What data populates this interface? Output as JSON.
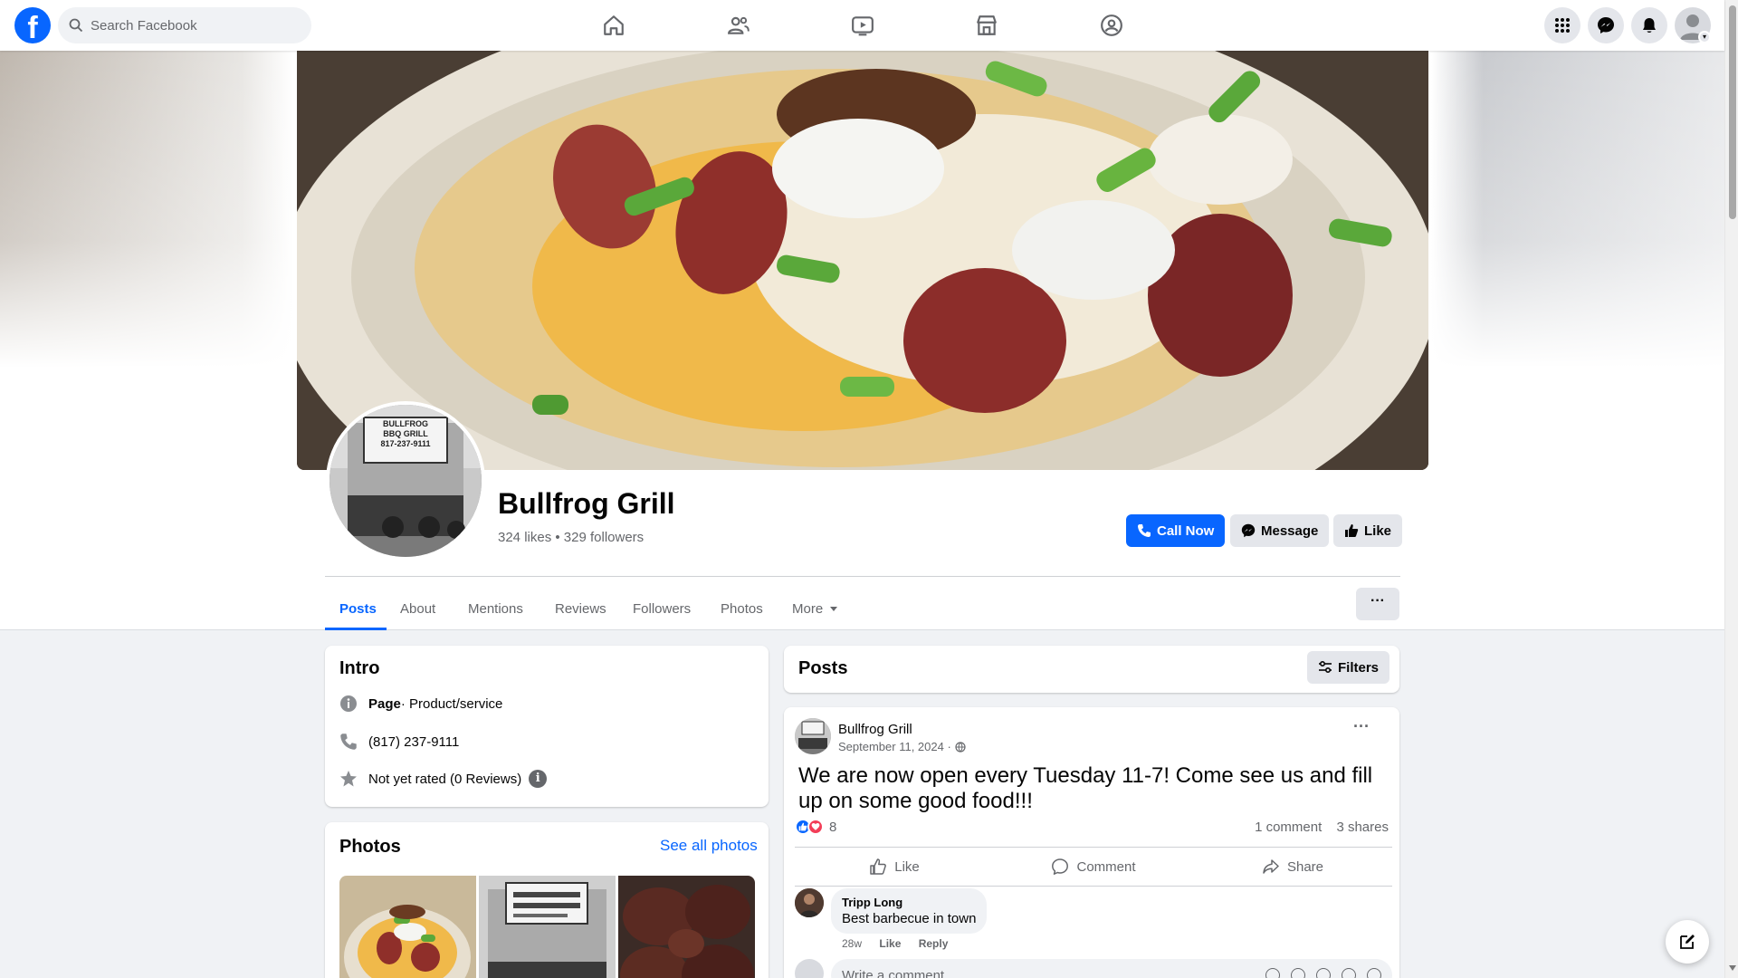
{
  "topbar": {
    "search_placeholder": "Search Facebook",
    "nav": [
      "home-icon",
      "friends-icon",
      "video-icon",
      "marketplace-icon",
      "gaming-icon"
    ],
    "right": [
      "menu-grid-icon",
      "messenger-icon",
      "notifications-icon",
      "account-avatar"
    ]
  },
  "page": {
    "name": "Bullfrog Grill",
    "stats": "324 likes • 329 followers",
    "profile_sign_line1": "BULLFROG",
    "profile_sign_line2": "BBQ GRILL",
    "profile_sign_line3": "817-237-9111"
  },
  "buttons": {
    "call_now": "Call Now",
    "message": "Message",
    "like": "Like",
    "more_options": "···"
  },
  "tabs": [
    {
      "label": "Posts"
    },
    {
      "label": "About"
    },
    {
      "label": "Mentions"
    },
    {
      "label": "Reviews"
    },
    {
      "label": "Followers"
    },
    {
      "label": "Photos"
    },
    {
      "label": "More"
    }
  ],
  "intro": {
    "title": "Intro",
    "category_bold": "Page",
    "category_rest": " · Product/service",
    "phone": "(817) 237-9111",
    "rating": "Not yet rated (0 Reviews)",
    "info_glyph": "i"
  },
  "photos": {
    "title": "Photos",
    "see_all": "See all photos"
  },
  "posts_header": {
    "title": "Posts",
    "filters": "Filters"
  },
  "post": {
    "author": "Bullfrog Grill",
    "date": "September 11, 2024 ·",
    "menu": "···",
    "text": "We are now open every Tuesday 11-7! Come see us and fill up on some good food!!!",
    "reaction_count": "8",
    "comments": "1 comment",
    "shares": "3 shares",
    "actions": {
      "like": "Like",
      "comment": "Comment",
      "share": "Share"
    }
  },
  "comment": {
    "name": "Tripp Long",
    "text": "Best barbecue in town",
    "ago": "28w",
    "like": "Like",
    "reply": "Reply"
  },
  "write_comment": {
    "placeholder": "Write a comment..."
  },
  "colors": {
    "brand_blue": "#0866ff",
    "secondary_bg": "#e4e6eb",
    "page_bg": "#f0f2f5",
    "muted_text": "#65676b"
  }
}
